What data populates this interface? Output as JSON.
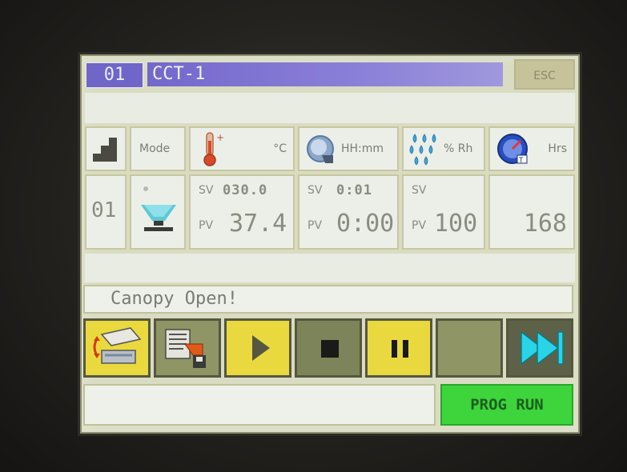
{
  "header": {
    "screen_number": "01",
    "title": "CCT-1",
    "esc_label": "ESC"
  },
  "columns": {
    "mode_label": "Mode",
    "temp_unit": "°C",
    "time_unit": "HH:mm",
    "humidity_unit": "% Rh",
    "hours_unit": "Hrs"
  },
  "values": {
    "step": "01",
    "temperature": {
      "sv_label": "SV",
      "sv": "030.0",
      "pv_label": "PV",
      "pv": "37.4"
    },
    "time": {
      "sv_label": "SV",
      "sv": "0:01",
      "pv_label": "PV",
      "pv": "0:00"
    },
    "humidity": {
      "sv_label": "SV",
      "sv": "",
      "pv_label": "PV",
      "pv": "100"
    },
    "hours": "168"
  },
  "message": "Canopy Open!",
  "status": {
    "prog_run_label": "PROG RUN"
  },
  "icons": {
    "step": "step-stairs-icon",
    "mode": "spray-nozzle-icon",
    "temperature": "thermometer-icon",
    "time": "clock-icon",
    "humidity": "water-drops-icon",
    "hours": "gauge-icon",
    "buttons": [
      "canopy-open-icon",
      "program-edit-icon",
      "play-icon",
      "stop-icon",
      "pause-icon",
      "blank",
      "skip-next-icon"
    ]
  },
  "colors": {
    "title_bar": "#7467cc",
    "button_yellow": "#e9d93f",
    "prog_run_green": "#3ed43c",
    "skip_cyan": "#2ad4e8"
  }
}
